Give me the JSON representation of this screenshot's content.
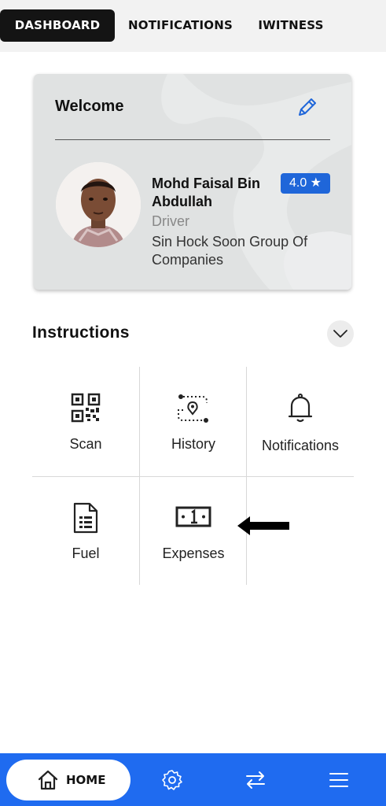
{
  "tabs": [
    {
      "label": "DASHBOARD",
      "active": true
    },
    {
      "label": "NOTIFICATIONS",
      "active": false
    },
    {
      "label": "IWITNESS",
      "active": false
    }
  ],
  "profile": {
    "welcome": "Welcome",
    "name": "Mohd Faisal Bin Abdullah",
    "rating": "4.0 ★",
    "role": "Driver",
    "company": "Sin Hock Soon Group Of Companies"
  },
  "instructions": {
    "title": "Instructions",
    "items": [
      {
        "label": "Scan",
        "icon": "qr-code-icon"
      },
      {
        "label": "History",
        "icon": "route-history-icon"
      },
      {
        "label": "Notifications",
        "icon": "bell-icon"
      },
      {
        "label": "Fuel",
        "icon": "document-icon"
      },
      {
        "label": "Expenses",
        "icon": "banknote-icon"
      }
    ]
  },
  "bottom_nav": {
    "home_label": "HOME",
    "icons": [
      "home-icon",
      "settings-icon",
      "transfer-icon",
      "menu-icon"
    ]
  },
  "colors": {
    "accent": "#1f6bf0",
    "badge": "#1f66d9",
    "active_tab": "#141414"
  }
}
